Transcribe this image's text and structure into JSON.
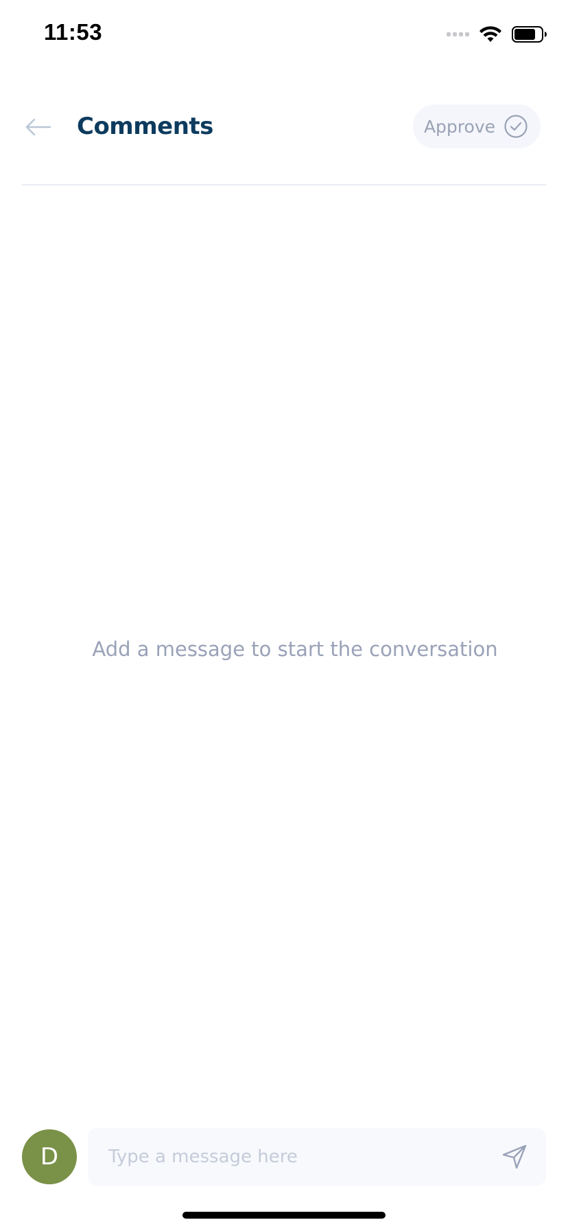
{
  "status_bar": {
    "time": "11:53",
    "icons": [
      "signal-icon",
      "wifi-icon",
      "battery-icon"
    ]
  },
  "header": {
    "title": "Comments",
    "back_icon": "arrow-left-icon",
    "approve_label": "Approve",
    "approve_icon": "check-circle-icon"
  },
  "empty_state": {
    "text": "Add a message to start the conversation"
  },
  "composer": {
    "avatar_initial": "D",
    "placeholder": "Type a message here",
    "value": "",
    "send_icon": "send-icon"
  },
  "colors": {
    "title": "#0d3b5e",
    "muted": "#9aa2b8",
    "avatar": "#7a9148",
    "approve_bg": "#f4f6fb",
    "input_bg": "#f7f9fd"
  }
}
